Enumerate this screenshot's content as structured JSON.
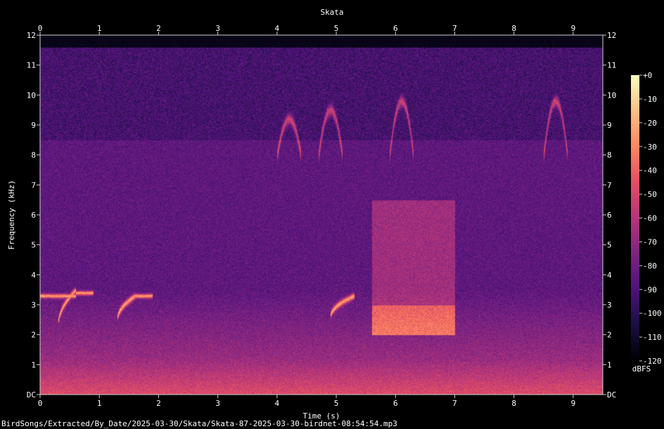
{
  "chart_data": {
    "type": "heatmap",
    "title": "Skata",
    "xlabel": "Time (s)",
    "ylabel": "Frequency (kHz)",
    "x_ticks": [
      0,
      1,
      2,
      3,
      4,
      5,
      6,
      7,
      8,
      9
    ],
    "x_range": [
      0,
      9.5
    ],
    "y_ticks": [
      "DC",
      "1",
      "2",
      "3",
      "4",
      "5",
      "6",
      "7",
      "8",
      "9",
      "10",
      "11",
      "12"
    ],
    "y_range": [
      0,
      12
    ],
    "colorbar": {
      "unit": "dBFS",
      "ticks": [
        "+0",
        "-10",
        "-20",
        "-30",
        "-40",
        "-50",
        "-60",
        "-70",
        "-80",
        "-90",
        "-100",
        "-110",
        "-120"
      ],
      "range": [
        -120,
        0
      ],
      "colormap": "magma"
    },
    "content_upper_limit_khz": 11.6,
    "features": [
      {
        "kind": "tone",
        "t": [
          0.0,
          0.6
        ],
        "f": [
          3.3,
          3.3
        ]
      },
      {
        "kind": "sweep",
        "t": [
          0.3,
          0.6
        ],
        "f": [
          2.3,
          3.5
        ]
      },
      {
        "kind": "tone",
        "t": [
          0.6,
          0.9
        ],
        "f": [
          3.4,
          3.4
        ]
      },
      {
        "kind": "sweep",
        "t": [
          1.3,
          1.6
        ],
        "f": [
          2.5,
          3.3
        ]
      },
      {
        "kind": "tone",
        "t": [
          1.6,
          1.9
        ],
        "f": [
          3.3,
          3.3
        ]
      },
      {
        "kind": "sweep",
        "t": [
          4.9,
          5.3
        ],
        "f": [
          2.6,
          3.3
        ]
      },
      {
        "kind": "burst",
        "t": [
          5.6,
          7.0
        ],
        "f": [
          2.0,
          6.5
        ]
      },
      {
        "kind": "arch",
        "t": [
          4.7,
          5.1
        ],
        "f": [
          8.0,
          9.5
        ]
      },
      {
        "kind": "arch",
        "t": [
          5.9,
          6.3
        ],
        "f": [
          8.0,
          9.8
        ]
      },
      {
        "kind": "arch",
        "t": [
          8.5,
          8.9
        ],
        "f": [
          8.0,
          9.8
        ]
      },
      {
        "kind": "arch",
        "t": [
          4.0,
          4.4
        ],
        "f": [
          8.0,
          9.2
        ]
      }
    ]
  },
  "footer": {
    "file_path": "BirdSongs/Extracted/By_Date/2025-03-30/Skata/Skata-87-2025-03-30-birdnet-08:54:54.mp3"
  }
}
